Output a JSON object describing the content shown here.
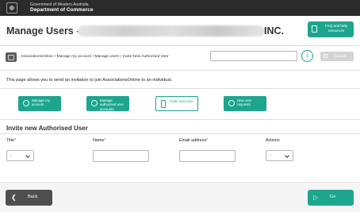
{
  "header": {
    "government_line": "Government of Western Australia",
    "department_line": "Department of Commerce"
  },
  "title": {
    "prefix": "Manage Users -",
    "suffix": "INC."
  },
  "faq_button": {
    "label": "FAQ and help resources"
  },
  "breadcrumb": {
    "items": [
      "AssociationsOnline",
      "Manage my account",
      "Manage users",
      "Invite New Authorised User"
    ],
    "separator": ">"
  },
  "search": {
    "value": "",
    "placeholder": "",
    "info_symbol": "i",
    "button_label": "Search"
  },
  "intro_text": "This page allows you to send an invitation to join AssociationsOnline to an individual.",
  "tiles": [
    {
      "label": "Manage my account",
      "icon": "account-icon",
      "active": false
    },
    {
      "label": "Manage authorised user accounts",
      "icon": "users-icon",
      "active": false
    },
    {
      "label": "Invite new user",
      "icon": "invite-user-icon",
      "active": true
    },
    {
      "label": "New user requests",
      "icon": "user-requests-icon",
      "active": false
    }
  ],
  "form": {
    "heading": "Invite new Authorised User",
    "columns": {
      "title": "Title",
      "name": "Name",
      "email": "Email address",
      "actions": "Actions"
    },
    "required_marker": "*",
    "title_select_value": "-",
    "name_value": "",
    "email_value": "",
    "actions_select_value": "-"
  },
  "footer": {
    "back_label": "Back",
    "back_icon": "chevron-left-icon",
    "go_label": "Go",
    "go_icon": "play-icon"
  },
  "colors": {
    "accent": "#1ea58e",
    "topbar": "#2b2b2b",
    "back_button": "#4f4f4f"
  }
}
